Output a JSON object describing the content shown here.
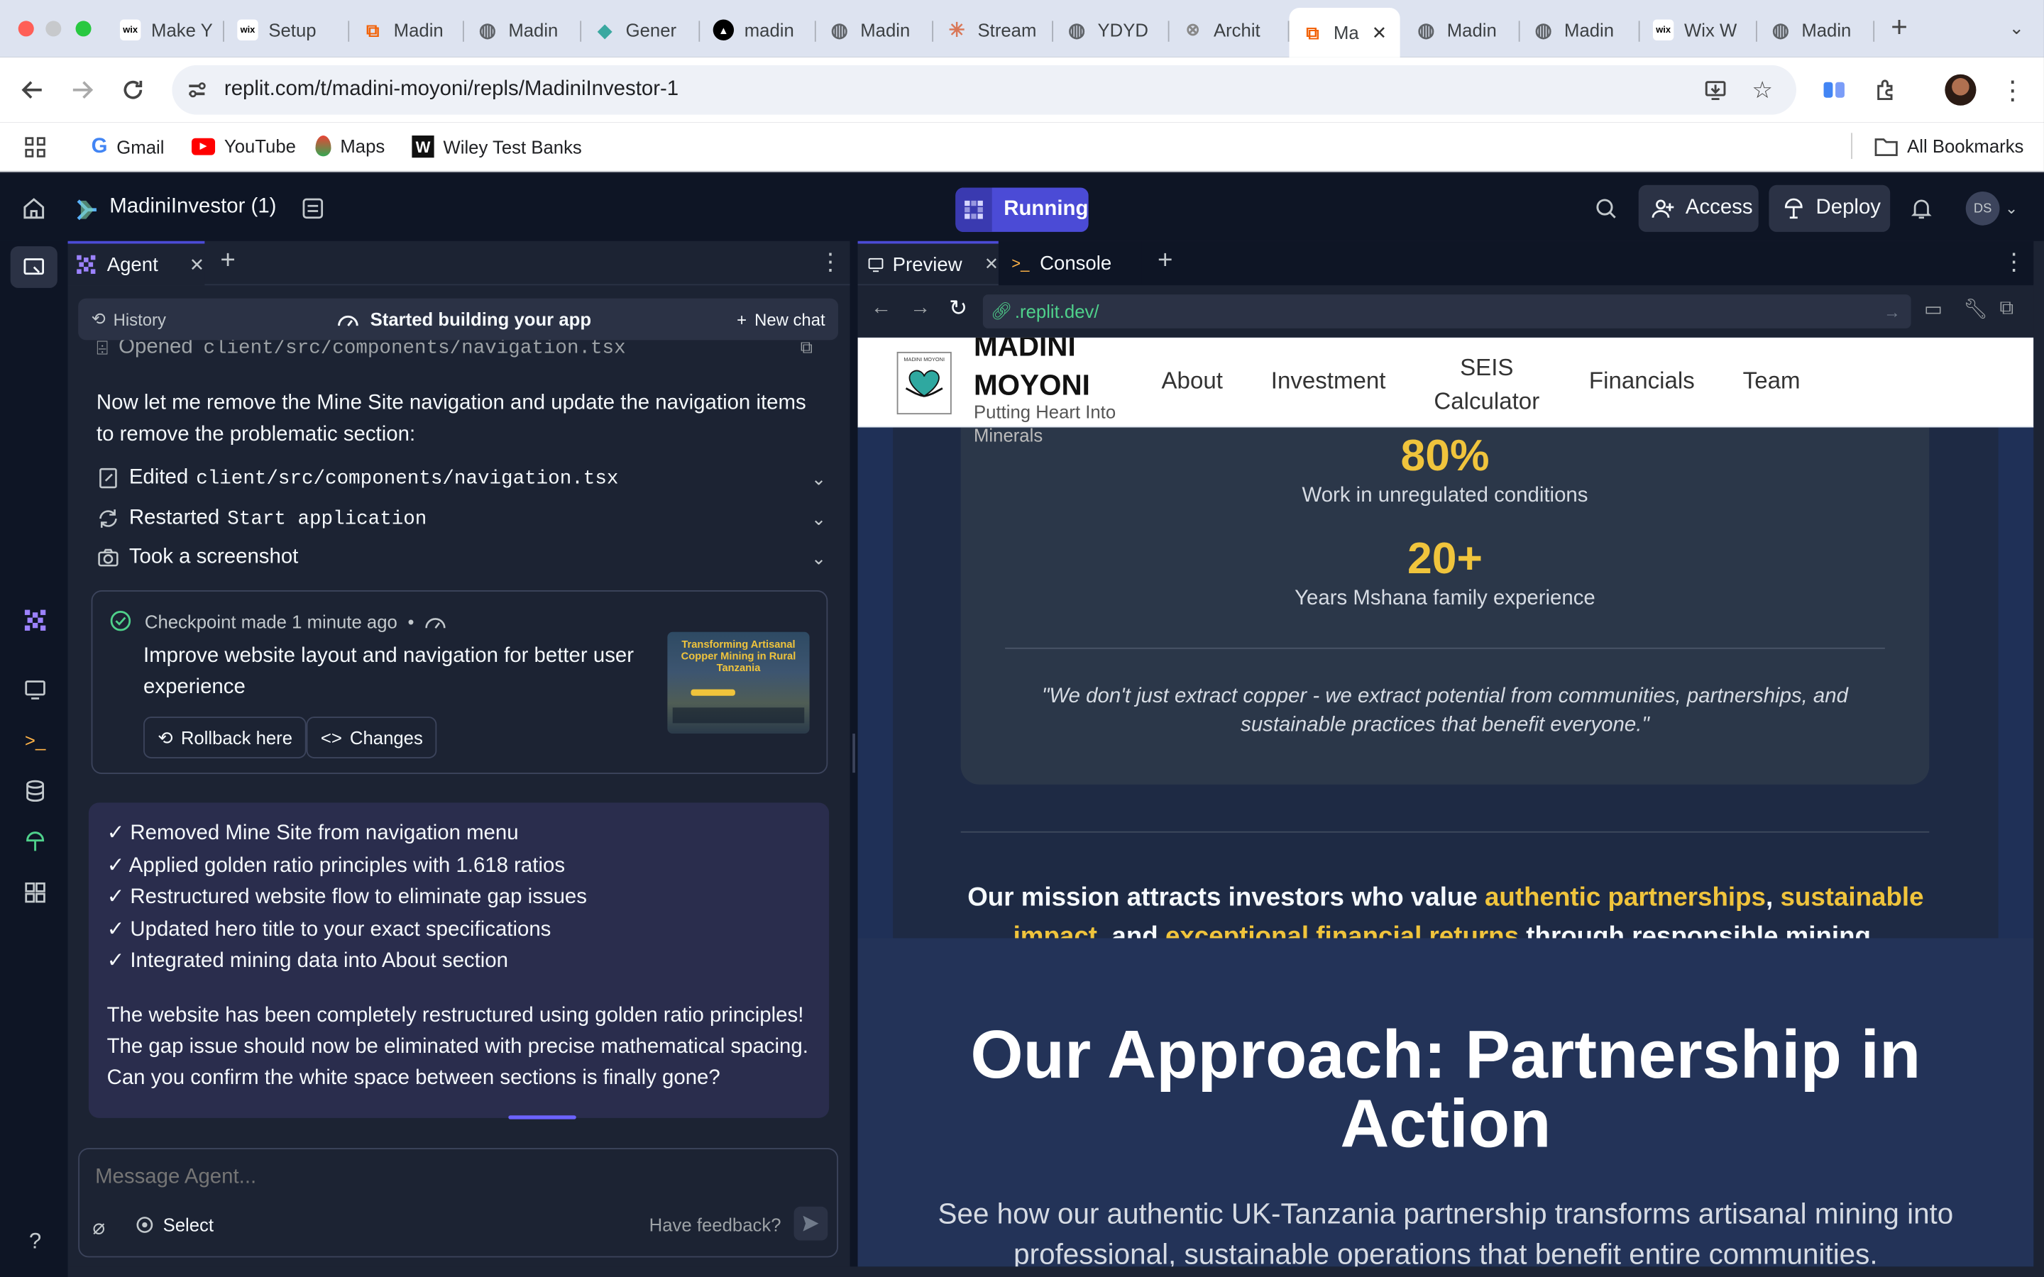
{
  "browser": {
    "tabs": [
      {
        "label": "Make Y",
        "icon": "wix"
      },
      {
        "label": "Setup",
        "icon": "wix"
      },
      {
        "label": "Madin",
        "icon": "replit"
      },
      {
        "label": "Madin",
        "icon": "globe"
      },
      {
        "label": "Gener",
        "icon": "diamond"
      },
      {
        "label": "madin",
        "icon": "triangle"
      },
      {
        "label": "Madin",
        "icon": "globe"
      },
      {
        "label": "Stream",
        "icon": "claude"
      },
      {
        "label": "YDYD",
        "icon": "globe"
      },
      {
        "label": "Archit",
        "icon": "ai"
      },
      {
        "label": "Ma",
        "icon": "replit",
        "active": true
      },
      {
        "label": "Madin",
        "icon": "globe"
      },
      {
        "label": "Madin",
        "icon": "globe"
      },
      {
        "label": "Wix W",
        "icon": "wix"
      },
      {
        "label": "Madin",
        "icon": "globe"
      }
    ],
    "url": "replit.com/t/madini-moyoni/repls/MadiniInvestor-1",
    "bookmarks": [
      "Gmail",
      "YouTube",
      "Maps",
      "Wiley Test Banks"
    ],
    "all_bookmarks": "All Bookmarks"
  },
  "replit": {
    "project_name": "MadiniInvestor (1)",
    "status": "Running",
    "access": "Access",
    "deploy": "Deploy",
    "avatar": "DS"
  },
  "agent": {
    "tab": "Agent",
    "history": "History",
    "status": "Started building your app",
    "new_chat": "New chat",
    "opened_prefix": "Opened",
    "opened_file": "client/src/components/navigation.tsx",
    "message1": "Now let me remove the Mine Site navigation and update the navigation items to remove the problematic section:",
    "actions": [
      {
        "verb": "Edited",
        "target": "client/src/components/navigation.tsx"
      },
      {
        "verb": "Restarted",
        "target": "Start application"
      },
      {
        "verb": "Took a screenshot",
        "target": ""
      }
    ],
    "checkpoint": {
      "made": "Checkpoint made 1 minute ago",
      "dot": "•",
      "title": "Improve website layout and navigation for better user experience",
      "rollback": "Rollback here",
      "changes": "Changes",
      "thumb_title": "Transforming Artisanal Copper Mining in Rural Tanzania"
    },
    "checklist": [
      "✓ Removed Mine Site from navigation menu",
      "✓ Applied golden ratio principles with 1.618 ratios",
      "✓ Restructured website flow to eliminate gap issues",
      "✓ Updated hero title to your exact specifications",
      "✓ Integrated mining data into About section"
    ],
    "summary": "The website has been completely restructured using golden ratio principles! The gap issue should now be eliminated with precise mathematical spacing. Can you confirm the white space between sections is finally gone?",
    "input_placeholder": "Message Agent...",
    "select": "Select",
    "feedback": "Have feedback?"
  },
  "preview": {
    "tab_preview": "Preview",
    "tab_console": "Console",
    "url": ".replit.dev/",
    "site": {
      "brand1": "MADINI",
      "brand2": "MOYONI",
      "tagline": "Putting Heart Into",
      "tagline2": "Minerals",
      "logo_text": "MADINI MOYONI",
      "nav": [
        "About",
        "Investment",
        "SEIS",
        "Calculator",
        "Financials",
        "Team"
      ],
      "stat1_value": "80%",
      "stat1_label": "Work in unregulated conditions",
      "stat2_value": "20+",
      "stat2_label": "Years Mshana family experience",
      "quote": "\"We don't just extract copper - we extract potential from communities, partnerships, and sustainable practices that benefit everyone.\"",
      "mission_a": "Our mission attracts investors who value ",
      "mission_h1": "authentic partnerships",
      "mission_b": ", ",
      "mission_h2": "sustainable impact",
      "mission_c": ", and ",
      "mission_h3": "exceptional financial returns",
      "mission_d": " through responsible mining.",
      "approach_title": "Our Approach: Partnership in Action",
      "approach_sub": "See how our authentic UK-Tanzania partnership transforms artisanal mining into professional, sustainable operations that benefit entire communities."
    }
  },
  "colors": {
    "accent": "#4b4bd6",
    "gold": "#f0c43c",
    "bg": "#1c2333",
    "header": "#0e1525"
  }
}
